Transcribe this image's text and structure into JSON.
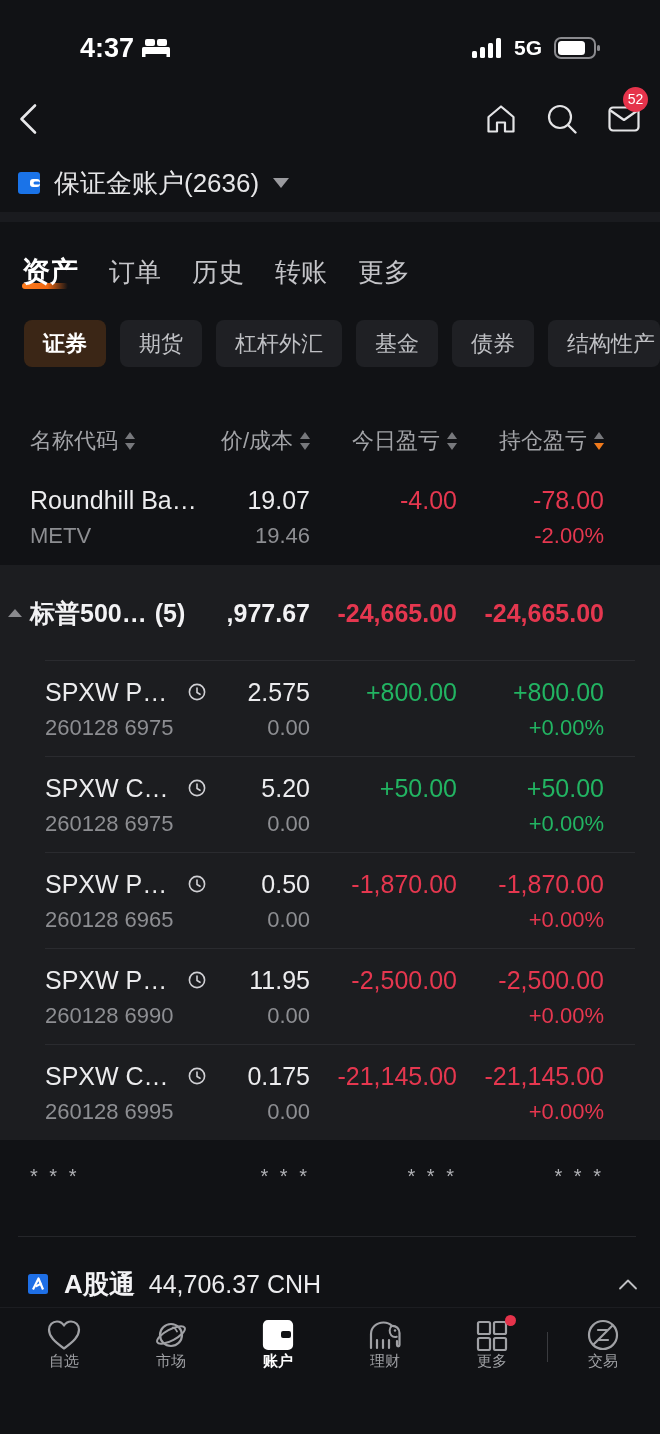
{
  "status_bar": {
    "time": "4:37",
    "network": "5G"
  },
  "header": {
    "mail_badge": "52"
  },
  "account": {
    "title": "保证金账户(2636)"
  },
  "tabs": [
    {
      "label": "资产",
      "selected": true
    },
    {
      "label": "订单",
      "selected": false
    },
    {
      "label": "历史",
      "selected": false
    },
    {
      "label": "转账",
      "selected": false
    },
    {
      "label": "更多",
      "selected": false
    }
  ],
  "categories": [
    {
      "label": "证券",
      "selected": true
    },
    {
      "label": "期货",
      "selected": false
    },
    {
      "label": "杠杆外汇",
      "selected": false
    },
    {
      "label": "基金",
      "selected": false
    },
    {
      "label": "债券",
      "selected": false
    },
    {
      "label": "结构性产",
      "selected": false
    }
  ],
  "holdings": {
    "columns": [
      {
        "label": "名称代码",
        "sorted": false
      },
      {
        "label": "价/成本",
        "sorted": false
      },
      {
        "label": "今日盈亏",
        "sorted": false
      },
      {
        "label": "持仓盈亏",
        "sorted": true
      }
    ],
    "rows": [
      {
        "name": "Roundhill Ba…",
        "code": "METV",
        "price": "19.07",
        "cost": "19.46",
        "today_pl": "-4.00",
        "position_pl": "-78.00",
        "position_pl_pct": "-2.00%",
        "gain": false,
        "clock": false
      }
    ],
    "group": {
      "name": "标普500…",
      "count": "(5)",
      "price": ",977.67",
      "today_pl": "-24,665.00",
      "position_pl": "-24,665.00",
      "gain": false,
      "expanded": true,
      "rows": [
        {
          "name": "SPXW P…",
          "code": "260128 6975",
          "price": "2.575",
          "cost": "0.00",
          "today_pl": "+800.00",
          "position_pl": "+800.00",
          "position_pl_pct": "+0.00%",
          "gain": true,
          "clock": true
        },
        {
          "name": "SPXW C…",
          "code": "260128 6975",
          "price": "5.20",
          "cost": "0.00",
          "today_pl": "+50.00",
          "position_pl": "+50.00",
          "position_pl_pct": "+0.00%",
          "gain": true,
          "clock": true
        },
        {
          "name": "SPXW P…",
          "code": "260128 6965",
          "price": "0.50",
          "cost": "0.00",
          "today_pl": "-1,870.00",
          "position_pl": "-1,870.00",
          "position_pl_pct": "+0.00%",
          "gain": false,
          "clock": true
        },
        {
          "name": "SPXW P…",
          "code": "260128 6990",
          "price": "11.95",
          "cost": "0.00",
          "today_pl": "-2,500.00",
          "position_pl": "-2,500.00",
          "position_pl_pct": "+0.00%",
          "gain": false,
          "clock": true
        },
        {
          "name": "SPXW C…",
          "code": "260128 6995",
          "price": "0.175",
          "cost": "0.00",
          "today_pl": "-21,145.00",
          "position_pl": "-21,145.00",
          "position_pl_pct": "+0.00%",
          "gain": false,
          "clock": true
        }
      ]
    },
    "hidden_values": [
      "* * *",
      "* * *",
      "* * *",
      "* * *"
    ]
  },
  "a_share_section": {
    "title": "A股通",
    "amount": "44,706.37 CNH",
    "expanded": true
  },
  "bottom_tabs": [
    {
      "label": "自选",
      "selected": false,
      "dot": false
    },
    {
      "label": "市场",
      "selected": false,
      "dot": false
    },
    {
      "label": "账户",
      "selected": true,
      "dot": false
    },
    {
      "label": "理财",
      "selected": false,
      "dot": false
    },
    {
      "label": "更多",
      "selected": false,
      "dot": true
    },
    {
      "label": "交易",
      "selected": false,
      "dot": false
    }
  ]
}
